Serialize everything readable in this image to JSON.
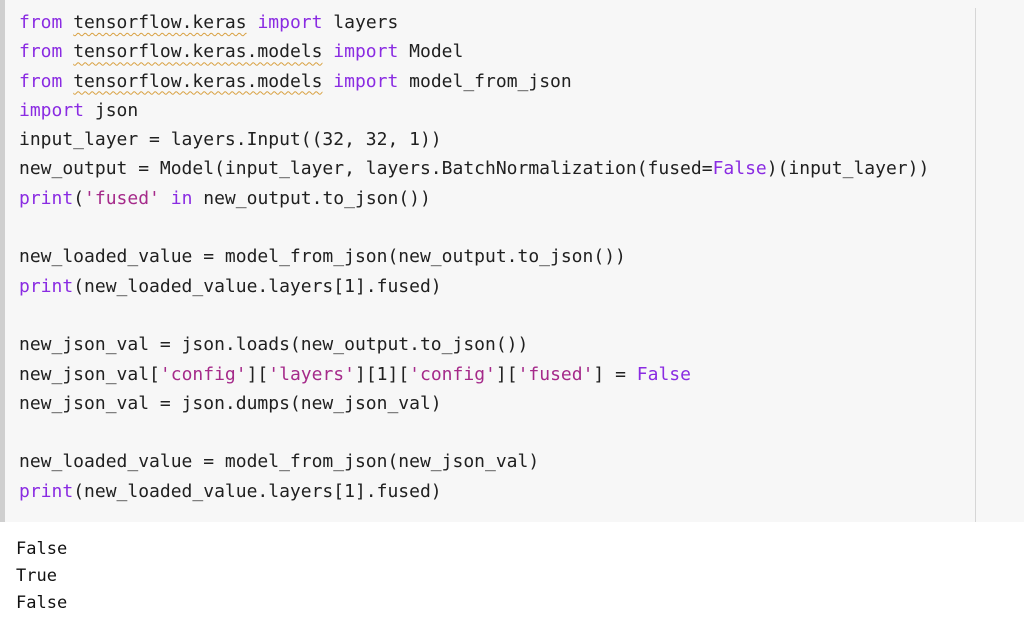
{
  "code_cell": {
    "lines": [
      [
        {
          "text": "from",
          "cls": "kw"
        },
        {
          "text": " ",
          "cls": "nm"
        },
        {
          "text": "tensorflow.keras",
          "cls": "nm squiggle"
        },
        {
          "text": " ",
          "cls": "nm"
        },
        {
          "text": "import",
          "cls": "kw"
        },
        {
          "text": " layers",
          "cls": "nm"
        }
      ],
      [
        {
          "text": "from",
          "cls": "kw"
        },
        {
          "text": " ",
          "cls": "nm"
        },
        {
          "text": "tensorflow.keras.models",
          "cls": "nm squiggle"
        },
        {
          "text": " ",
          "cls": "nm"
        },
        {
          "text": "import",
          "cls": "kw"
        },
        {
          "text": " Model",
          "cls": "nm"
        }
      ],
      [
        {
          "text": "from",
          "cls": "kw"
        },
        {
          "text": " ",
          "cls": "nm"
        },
        {
          "text": "tensorflow.keras.models",
          "cls": "nm squiggle"
        },
        {
          "text": " ",
          "cls": "nm"
        },
        {
          "text": "import",
          "cls": "kw"
        },
        {
          "text": " model_from_json",
          "cls": "nm"
        }
      ],
      [
        {
          "text": "import",
          "cls": "kw"
        },
        {
          "text": " json",
          "cls": "nm"
        }
      ],
      [
        {
          "text": "input_layer = layers.Input((32, 32, 1))",
          "cls": "nm"
        }
      ],
      [
        {
          "text": "new_output = Model(input_layer, layers.BatchNormalization(fused=",
          "cls": "nm"
        },
        {
          "text": "False",
          "cls": "kw"
        },
        {
          "text": ")(input_layer))",
          "cls": "nm"
        }
      ],
      [
        {
          "text": "print",
          "cls": "bi"
        },
        {
          "text": "(",
          "cls": "nm"
        },
        {
          "text": "'fused'",
          "cls": "st"
        },
        {
          "text": " ",
          "cls": "nm"
        },
        {
          "text": "in",
          "cls": "kw"
        },
        {
          "text": " new_output.to_json())",
          "cls": "nm"
        }
      ],
      [],
      [
        {
          "text": "new_loaded_value = model_from_json(new_output.to_json())",
          "cls": "nm"
        }
      ],
      [
        {
          "text": "print",
          "cls": "bi"
        },
        {
          "text": "(new_loaded_value.layers[1].fused)",
          "cls": "nm"
        }
      ],
      [],
      [
        {
          "text": "new_json_val = json.loads(new_output.to_json())",
          "cls": "nm"
        }
      ],
      [
        {
          "text": "new_json_val[",
          "cls": "nm"
        },
        {
          "text": "'config'",
          "cls": "st"
        },
        {
          "text": "][",
          "cls": "nm"
        },
        {
          "text": "'layers'",
          "cls": "st"
        },
        {
          "text": "][1][",
          "cls": "nm"
        },
        {
          "text": "'config'",
          "cls": "st"
        },
        {
          "text": "][",
          "cls": "nm"
        },
        {
          "text": "'fused'",
          "cls": "st"
        },
        {
          "text": "] = ",
          "cls": "nm"
        },
        {
          "text": "False",
          "cls": "kw"
        }
      ],
      [
        {
          "text": "new_json_val = json.dumps(new_json_val)",
          "cls": "nm"
        }
      ],
      [],
      [
        {
          "text": "new_loaded_value = model_from_json(new_json_val)",
          "cls": "nm"
        }
      ],
      [
        {
          "text": "print",
          "cls": "bi"
        },
        {
          "text": "(new_loaded_value.layers[1].fused)",
          "cls": "nm"
        }
      ]
    ]
  },
  "output": {
    "lines": [
      "False",
      "True",
      "False"
    ]
  },
  "colors": {
    "keyword": "#8a2be2",
    "string": "#a52a8a",
    "code_background": "#f7f7f7"
  }
}
